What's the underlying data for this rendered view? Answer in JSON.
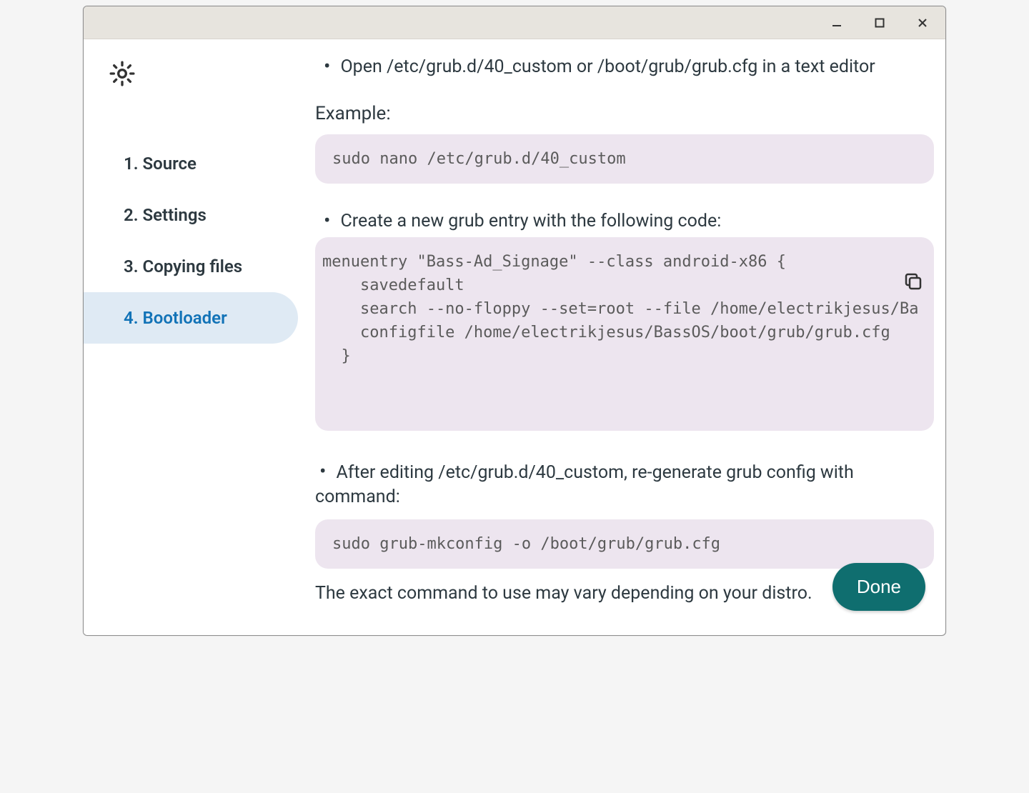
{
  "sidebar": {
    "items": [
      {
        "label": "1. Source"
      },
      {
        "label": "2. Settings"
      },
      {
        "label": "3. Copying files"
      },
      {
        "label": "4. Bootloader"
      }
    ],
    "active_index": 3
  },
  "content": {
    "bullet1": "Open /etc/grub.d/40_custom or /boot/grub/grub.cfg in a text editor",
    "example_label": "Example:",
    "code1": "sudo nano /etc/grub.d/40_custom",
    "bullet2": "Create a new grub entry with the following code:",
    "code2": "menuentry \"Bass-Ad_Signage\" --class android-x86 {\n    savedefault\n    search --no-floppy --set=root --file /home/electrikjesus/Ba\n    configfile /home/electrikjesus/BassOS/boot/grub/grub.cfg\n  }",
    "bullet3": "After editing /etc/grub.d/40_custom, re-generate grub config with command:",
    "code3": "sudo grub-mkconfig -o /boot/grub/grub.cfg",
    "footer": "The exact command to use may vary depending on your distro."
  },
  "buttons": {
    "done": "Done"
  }
}
